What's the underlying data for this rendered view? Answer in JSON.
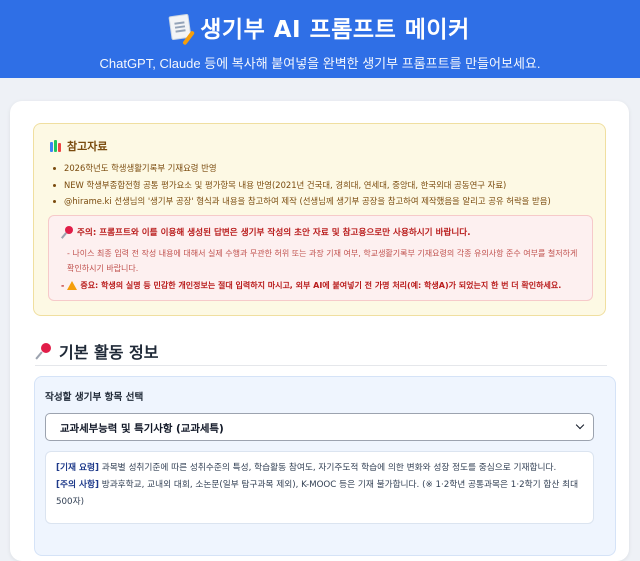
{
  "header": {
    "title": "생기부 AI 프롬프트 메이커",
    "subtitle": "ChatGPT, Claude 등에 복사해 붙여넣을 완벽한 생기부 프롬프트를 만들어보세요.",
    "icon": "memo-icon",
    "bg_color": "#2f6fe6"
  },
  "references": {
    "title": "참고자료",
    "icon": "books-icon",
    "items": [
      "2026학년도 학생생활기록부 기재요령 반영",
      "NEW 학생부종합전형 공통 평가요소 및 평가항목 내용 반영(2021년 건국대, 경희대, 연세대, 중앙대, 한국외대 공동연구 자료)",
      "@hirame.ki 선생님의 '생기부 공장' 형식과 내용을 참고하여 제작 (선생님께 생기부 공장을 참고하여 제작했음을 알리고 공유 허락을 받음)"
    ],
    "warning": {
      "title": "주의: 프롬프트와 이를 이용해 생성된 답변은 생기부 작성의 초안 자료 및 참고용으로만 사용하시기 바랍니다.",
      "body": "- 나이스 최종 입력 전 작성 내용에 대해서 실제 수행과 무관한 허위 또는 과장 기재 여부, 학교생활기록부 기재요령의 각종 유의사항 준수 여부를 철저하게 확인하시기 바랍니다.",
      "strong_prefix": "-",
      "strong": "중요: 학생의 실명 등 민감한 개인정보는 절대 입력하지 마시고, 외부 AI에 붙여넣기 전 가명 처리(예: 학생A)가 되었는지 한 번 더 확인하세요."
    }
  },
  "section": {
    "title": "기본 활동 정보",
    "icon": "pushpin-icon"
  },
  "form": {
    "select_label": "작성할 생기부 항목 선택",
    "selected_value": "교과세부능력 및 특기사항 (교과세특)",
    "info_tag1": "[기재 요령]",
    "info_text1": " 과목별 성취기준에 따른 성취수준의 특성, 학습활동 참여도, 자기주도적 학습에 의한 변화와 성장 정도를 중심으로 기재합니다.",
    "info_tag2": "[주의 사항]",
    "info_text2": " 방과후학교, 교내외 대회, 소논문(일부 탐구과목 제외), K-MOOC 등은 기재 불가합니다. (※ 1·2학년 공통과목은 1·2학기 합산 최대 500자)"
  }
}
